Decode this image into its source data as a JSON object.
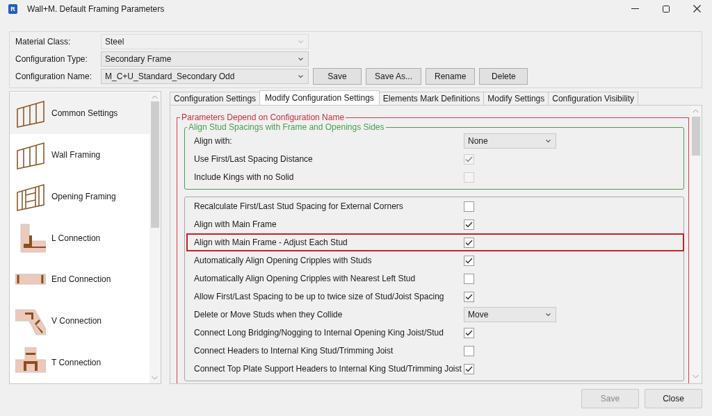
{
  "window": {
    "title": "Wall+M. Default Framing Parameters",
    "icon_text": "R"
  },
  "header": {
    "fields": [
      {
        "label": "Material Class:",
        "value": "Steel",
        "disabled": true
      },
      {
        "label": "Configuration Type:",
        "value": "Secondary Frame",
        "disabled": false
      },
      {
        "label": "Configuration Name:",
        "value": "M_C+U_Standard_Secondary Odd",
        "disabled": false
      }
    ],
    "buttons": [
      "Save",
      "Save As...",
      "Rename",
      "Delete"
    ]
  },
  "sidebar": {
    "items": [
      {
        "label": "Common Settings",
        "kind": "wall",
        "selected": true
      },
      {
        "label": "Wall Framing",
        "kind": "wall",
        "selected": false
      },
      {
        "label": "Opening Framing",
        "kind": "opening",
        "selected": false
      },
      {
        "label": "L Connection",
        "kind": "l",
        "selected": false
      },
      {
        "label": "End Connection",
        "kind": "end",
        "selected": false
      },
      {
        "label": "V Connection",
        "kind": "v",
        "selected": false
      },
      {
        "label": "T Connection",
        "kind": "t",
        "selected": false
      }
    ]
  },
  "tabs": [
    {
      "label": "Configuration Settings",
      "selected": false
    },
    {
      "label": "Modify Configuration Settings",
      "selected": true
    },
    {
      "label": "Elements Mark Definitions",
      "selected": false
    },
    {
      "label": "Modify Settings",
      "selected": false
    },
    {
      "label": "Configuration Visibility",
      "selected": false
    }
  ],
  "panel": {
    "title": "Parameters Depend on Configuration Name",
    "groups": [
      {
        "title": "Align Stud Spacings with Frame and Openings Sides",
        "color": "#4a9e4a",
        "rows": [
          {
            "kind": "dropdown",
            "label": "Align with:",
            "value": "None"
          },
          {
            "kind": "checkbox",
            "label": "Use First/Last Spacing Distance",
            "checked": true,
            "disabled": true
          },
          {
            "kind": "checkbox",
            "label": "Include Kings with no Solid",
            "checked": false,
            "disabled": true
          }
        ]
      },
      {
        "color": "#a8a8a8",
        "rows": [
          {
            "kind": "checkbox",
            "label": "Recalculate First/Last Stud Spacing for External Corners",
            "checked": false,
            "highlighted": false
          },
          {
            "kind": "checkbox",
            "label": "Align with Main Frame",
            "checked": true,
            "highlighted": false
          },
          {
            "kind": "checkbox",
            "label": "Align with Main Frame - Adjust Each Stud",
            "checked": true,
            "highlighted": true
          },
          {
            "kind": "checkbox",
            "label": "Automatically Align Opening Cripples with Studs",
            "checked": true,
            "highlighted": false
          },
          {
            "kind": "checkbox",
            "label": "Automatically Align Opening Cripples with Nearest Left Stud",
            "checked": false,
            "highlighted": false
          },
          {
            "kind": "checkbox",
            "label": "Allow First/Last Spacing to be up to twice size of Stud/Joist Spacing",
            "checked": true,
            "highlighted": false
          },
          {
            "kind": "dropdown",
            "label": "Delete or Move Studs when they Collide",
            "value": "Move",
            "highlighted": false
          },
          {
            "kind": "checkbox",
            "label": "Connect Long Bridging/Nogging to Internal Opening King Joist/Stud",
            "checked": true,
            "highlighted": false
          },
          {
            "kind": "checkbox",
            "label": "Connect Headers to Internal King Stud/Trimming Joist",
            "checked": false,
            "highlighted": false
          },
          {
            "kind": "checkbox",
            "label": "Connect Top Plate Support Headers to Internal King Stud/Trimming Joist",
            "checked": true,
            "highlighted": false
          }
        ]
      }
    ]
  },
  "footer": {
    "buttons": [
      {
        "label": "Save",
        "disabled": true
      },
      {
        "label": "Close",
        "disabled": false
      }
    ]
  }
}
